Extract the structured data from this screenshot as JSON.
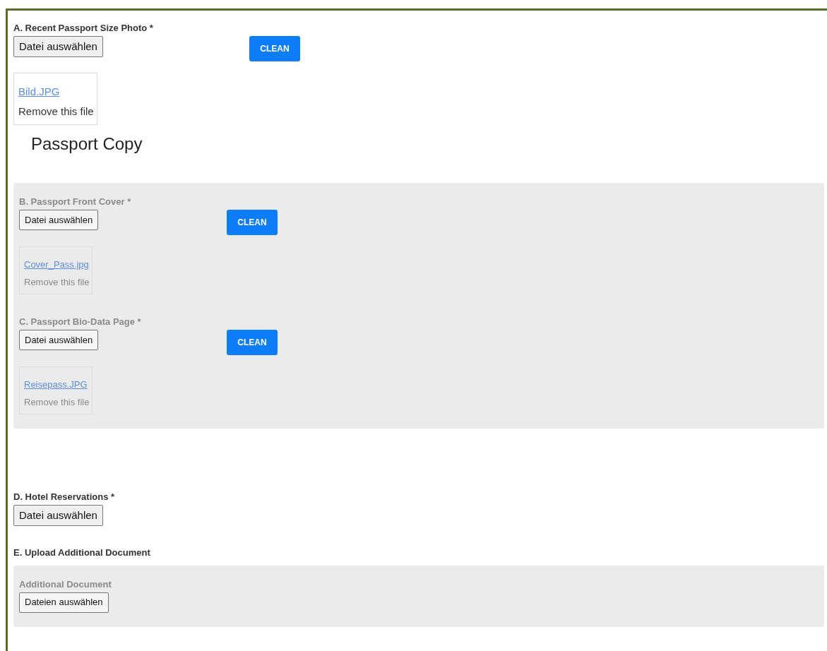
{
  "blocks": [
    {
      "kind": "field",
      "label": "A. Recent Passport Size Photo *",
      "chooser": "Datei auswählen",
      "clean": "CLEAN",
      "file": {
        "name": "Bild.JPG",
        "remove": "Remove this file"
      }
    },
    {
      "kind": "heading",
      "text": "Passport Copy"
    },
    {
      "kind": "panel",
      "disabled": true,
      "fields": [
        {
          "label": "B. Passport Front Cover *",
          "chooser": "Datei auswählen",
          "clean": "CLEAN",
          "file": {
            "name": "Cover_Pass.jpg",
            "remove": "Remove this file"
          }
        },
        {
          "label": "C. Passport Bio-Data Page *",
          "chooser": "Datei auswählen",
          "clean": "CLEAN",
          "file": {
            "name": "Reisepass.JPG",
            "remove": "Remove this file"
          }
        }
      ]
    },
    {
      "kind": "spacer"
    },
    {
      "kind": "field",
      "label": "D. Hotel Reservations *",
      "chooser": "Datei auswählen"
    },
    {
      "kind": "section_label",
      "text": "E. Upload Additional Document"
    },
    {
      "kind": "panel",
      "disabled": true,
      "fields": [
        {
          "label": "Additional Document",
          "chooser": "Dateien auswählen"
        }
      ]
    }
  ]
}
